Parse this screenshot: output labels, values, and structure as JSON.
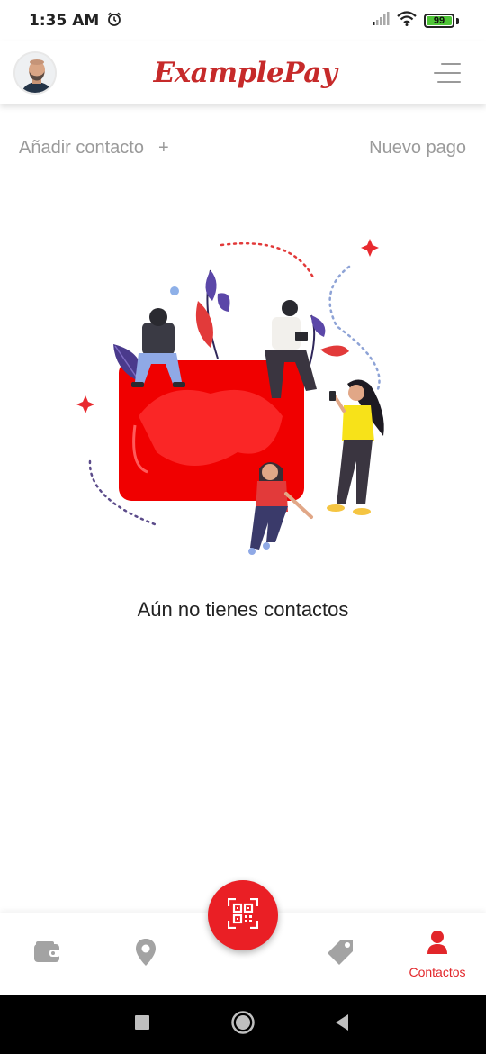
{
  "status_bar": {
    "time": "1:35 AM",
    "battery": "99",
    "icons": [
      "alarm-icon",
      "signal-icon",
      "wifi-icon",
      "battery-icon"
    ]
  },
  "header": {
    "brand": "ExamplePay",
    "brand_color": "#c62a2a",
    "avatar_icon": "user-avatar",
    "menu_icon": "hamburger-menu-icon"
  },
  "actions": {
    "add_contact": "Añadir contacto",
    "add_icon": "+",
    "new_payment": "Nuevo pago"
  },
  "empty_state": {
    "message": "Aún no tienes contactos",
    "illustration": "people-with-card-illustration"
  },
  "bottom_nav": {
    "accent_color": "#e2262a",
    "items": [
      {
        "icon": "wallet-icon",
        "label": ""
      },
      {
        "icon": "location-pin-icon",
        "label": ""
      },
      {
        "icon": "qr-code-icon",
        "label": ""
      },
      {
        "icon": "tag-icon",
        "label": ""
      },
      {
        "icon": "contacts-person-icon",
        "label": "Contactos"
      }
    ]
  },
  "system_nav": {
    "icons": [
      "recents-square-icon",
      "home-circle-icon",
      "back-triangle-icon"
    ]
  }
}
